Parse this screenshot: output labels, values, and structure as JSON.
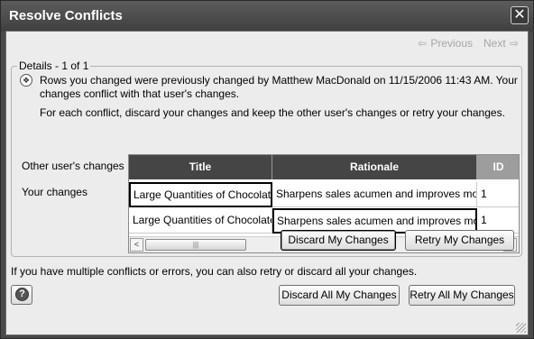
{
  "window": {
    "title": "Resolve Conflicts",
    "close_glyph": "✕"
  },
  "nav": {
    "previous_label": "Previous",
    "next_label": "Next",
    "previous_icon": "arrow-left-icon",
    "next_icon": "arrow-right-icon"
  },
  "details": {
    "legend": "Details - 1 of 1",
    "icon": "conflict-info-icon",
    "message_line1": "Rows you changed were previously changed by Matthew MacDonald on 11/15/2006 11:43 AM. Your",
    "message_line2": "changes conflict with that user's changes.",
    "instruction": "For each conflict, discard your changes and keep the other user's changes or retry your changes."
  },
  "grid": {
    "columns": [
      "Title",
      "Rationale",
      "ID"
    ],
    "rows": [
      {
        "label": "Other user's changes",
        "cells": [
          "Large Quantities of Chocolates",
          "Sharpens sales acumen and improves morale.",
          "1"
        ]
      },
      {
        "label": "Your changes",
        "cells": [
          "Large Quantities of Chocolate",
          "Sharpens sales acumen and improves morale",
          "1"
        ]
      }
    ],
    "scrollbar": {
      "left_glyph": "<",
      "right_glyph": ">",
      "thumb_grip": "|||"
    }
  },
  "buttons": {
    "discard_mine": "Discard My Changes",
    "retry_mine": "Retry My Changes",
    "discard_all": "Discard All My Changes",
    "retry_all": "Retry All My Changes",
    "help_glyph": "?"
  },
  "footer": {
    "note": "If you have multiple conflicts or errors, you can also retry or discard all your changes."
  }
}
